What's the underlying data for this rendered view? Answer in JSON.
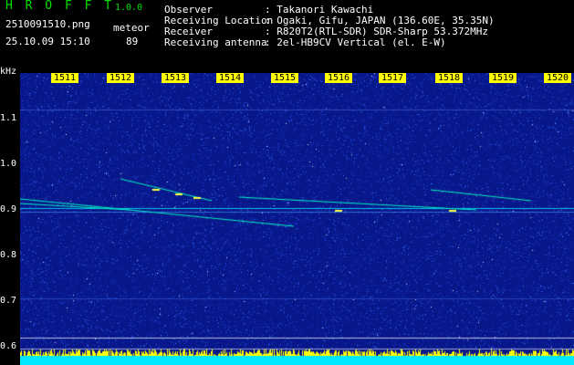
{
  "app": {
    "name": "H R O F F T",
    "version": "1.0.0"
  },
  "file": {
    "name": "2510091510.png",
    "datetime": "25.10.09 15:10"
  },
  "detection": {
    "label": "meteor",
    "count": "89"
  },
  "info": [
    {
      "label": "Observer",
      "value": ": Takanori Kawachi"
    },
    {
      "label": "Receiving Location",
      "value": ": Ogaki, Gifu, JAPAN (136.60E, 35.35N)"
    },
    {
      "label": "Receiver",
      "value": ": R820T2(RTL-SDR) SDR-Sharp 53.372MHz"
    },
    {
      "label": "Receiving antenna",
      "value": ": 2el-HB9CV Vertical (el. E-W)"
    }
  ],
  "spectrogram": {
    "unit": "kHz",
    "x_ticks": [
      "1511",
      "1512",
      "1513",
      "1514",
      "1515",
      "1516",
      "1517",
      "1518",
      "1519",
      "1520"
    ],
    "y_ticks": [
      "1.1",
      "1.0",
      "0.9",
      "0.8",
      "0.7",
      "0.6"
    ],
    "colors": {
      "bg": "#0a1a8c",
      "noise": "#2a5cff",
      "signal": "#ffff00",
      "mid": "#00e8ff"
    }
  }
}
